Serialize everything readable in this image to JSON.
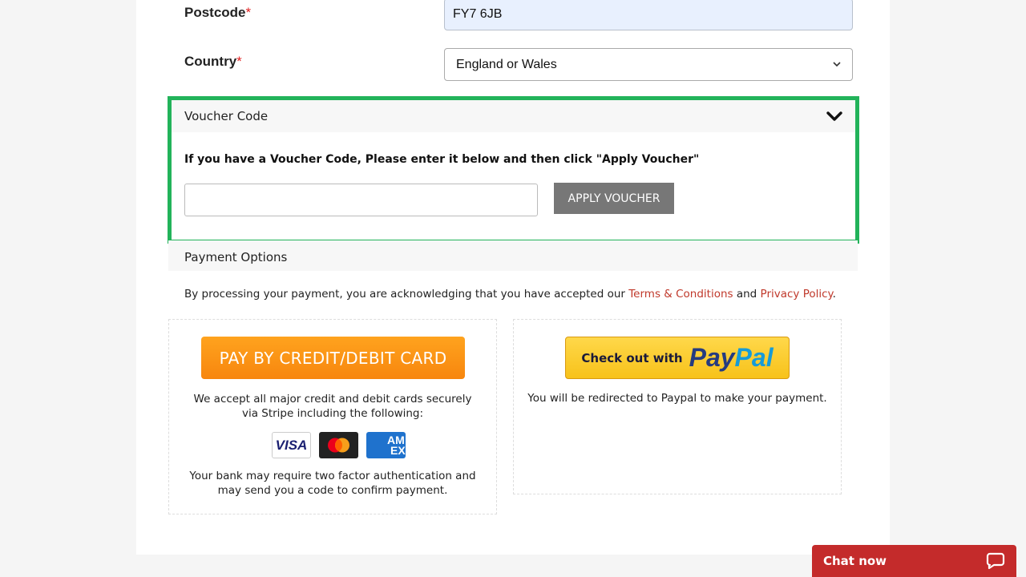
{
  "form": {
    "postcode_label": "Postcode",
    "postcode_value": "FY7 6JB",
    "country_label": "Country",
    "country_value": "England or Wales",
    "required_mark": "*"
  },
  "voucher": {
    "title": "Voucher Code",
    "instructions": "If you have a Voucher Code, Please enter it below and then click \"Apply Voucher\"",
    "input_value": "",
    "apply_label": "APPLY VOUCHER",
    "highlight_color": "#22b35a"
  },
  "payment": {
    "title": "Payment Options",
    "ack_prefix": "By processing your payment, you are acknowledging that you have accepted our ",
    "terms_link": "Terms & Conditions",
    "ack_and": " and ",
    "privacy_link": "Privacy Policy",
    "ack_suffix": ".",
    "card": {
      "button_label": "PAY BY CREDIT/DEBIT CARD",
      "accept_text": "We accept all major credit and debit cards securely via Stripe including the following:",
      "brands": [
        "VISA",
        "mastercard",
        "AMEX"
      ],
      "bank_text": "Your bank may require two factor authentication and may send you a code to confirm payment."
    },
    "paypal": {
      "button_prefix": "Check out with",
      "logo_pay": "Pay",
      "logo_pal": "Pal",
      "redirect_text": "You will be redirected to Paypal to make your payment."
    }
  },
  "chat": {
    "label": "Chat now",
    "icon": "chat-bubble-icon"
  }
}
